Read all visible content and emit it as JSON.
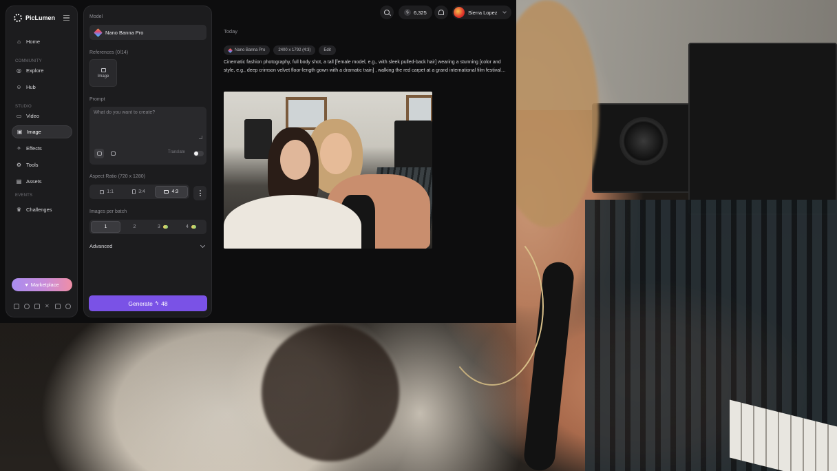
{
  "brand": {
    "name": "PicLumen"
  },
  "sidebar": {
    "items": [
      {
        "label": "Home",
        "icon": "home-icon"
      },
      {
        "label": "Explore",
        "icon": "compass-icon"
      },
      {
        "label": "Hub",
        "icon": "users-icon"
      },
      {
        "label": "Video",
        "icon": "video-icon"
      },
      {
        "label": "Image",
        "icon": "image-icon",
        "active": true
      },
      {
        "label": "Effects",
        "icon": "wand-icon"
      },
      {
        "label": "Tools",
        "icon": "tools-icon"
      },
      {
        "label": "Assets",
        "icon": "folder-icon"
      },
      {
        "label": "Challenges",
        "icon": "trophy-icon"
      }
    ],
    "sections": {
      "community": "COMMUNITY",
      "studio": "STUDIO",
      "events": "EVENTS"
    },
    "marketplace_label": "Marketplace",
    "social_icons": [
      "discord-icon",
      "facebook-icon",
      "instagram-icon",
      "x-icon",
      "youtube-icon",
      "tiktok-icon"
    ]
  },
  "generator": {
    "model_label": "Model",
    "model_value": "Nano Banna Pro",
    "references_label": "References (0/14)",
    "reference_button": "Image",
    "prompt_label": "Prompt",
    "prompt_placeholder": "What do you want to create?",
    "translate_label": "Translate",
    "aspect_label": "Aspect Ratio (720 x 1280)",
    "aspect_options": [
      "1:1",
      "3:4",
      "4:3"
    ],
    "aspect_selected": "4:3",
    "batch_label": "Images per batch",
    "batch_options": [
      "1",
      "2",
      "3",
      "4"
    ],
    "batch_selected": "1",
    "advanced_label": "Advanced",
    "generate_label": "Generate",
    "generate_cost": "48"
  },
  "topbar": {
    "credits": "6,325",
    "user_name": "Sierra Lopez"
  },
  "feed": {
    "date_label": "Today",
    "tags": {
      "model": "Nano Banna Pro",
      "size": "2400 x 1792 (4:3)",
      "edit": "Edit"
    },
    "prompt": "Cinematic fashion photography, full body shot, a tall [female model, e.g., with sleek pulled-back hair] wearing a stunning [color and style, e.g., deep crimson velvet floor-length gown with a dramatic train] , walking the red carpet at a grand international film festival premiere."
  },
  "colors": {
    "accent": "#7a52e6",
    "panel": "#1c1c1e",
    "background": "#0d0d0e"
  }
}
